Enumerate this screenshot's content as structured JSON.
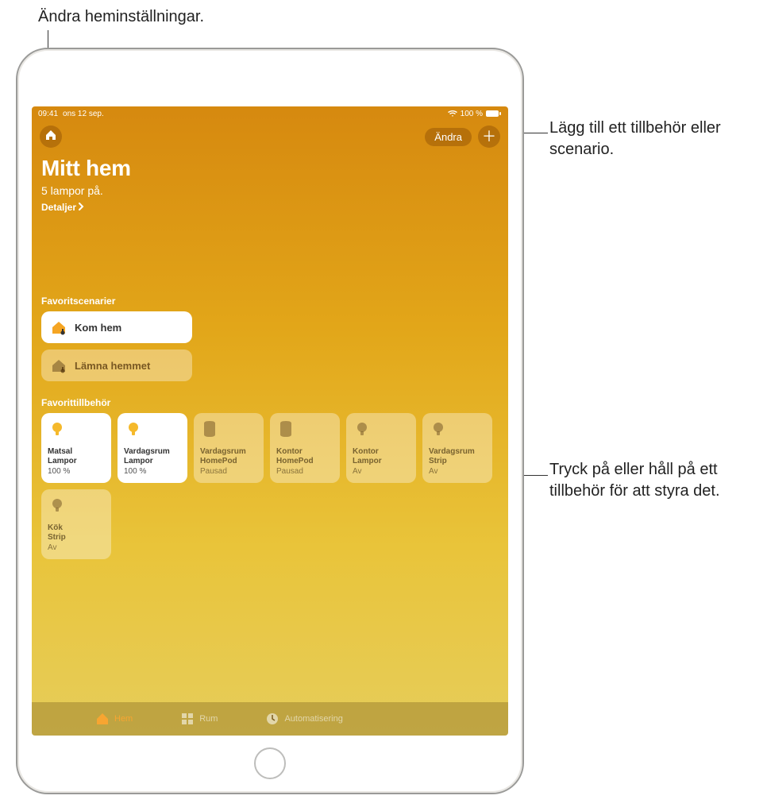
{
  "callouts": {
    "settings": "Ändra heminställningar.",
    "add": "Lägg till ett tillbehör eller scenario.",
    "accessory": "Tryck på eller håll på ett tillbehör för att styra det."
  },
  "statusBar": {
    "time": "09:41",
    "date": "ons 12 sep.",
    "battery": "100 %"
  },
  "header": {
    "editLabel": "Ändra",
    "title": "Mitt hem",
    "subtitle": "5 lampor på.",
    "detailsLabel": "Detaljer"
  },
  "sections": {
    "scenesLabel": "Favoritscenarier",
    "accessoriesLabel": "Favorittillbehör"
  },
  "scenes": [
    {
      "label": "Kom hem",
      "active": true,
      "icon": "arrive-home"
    },
    {
      "label": "Lämna hemmet",
      "active": false,
      "icon": "leave-home"
    }
  ],
  "accessories": [
    {
      "room": "Matsal",
      "name": "Lampor",
      "status": "100 %",
      "on": true,
      "icon": "bulb"
    },
    {
      "room": "Vardagsrum",
      "name": "Lampor",
      "status": "100 %",
      "on": true,
      "icon": "bulb"
    },
    {
      "room": "Vardagsrum",
      "name": "HomePod",
      "status": "Pausad",
      "on": false,
      "icon": "homepod"
    },
    {
      "room": "Kontor",
      "name": "HomePod",
      "status": "Pausad",
      "on": false,
      "icon": "homepod"
    },
    {
      "room": "Kontor",
      "name": "Lampor",
      "status": "Av",
      "on": false,
      "icon": "bulb"
    },
    {
      "room": "Vardagsrum",
      "name": "Strip",
      "status": "Av",
      "on": false,
      "icon": "bulb"
    },
    {
      "room": "Kök",
      "name": "Strip",
      "status": "Av",
      "on": false,
      "icon": "bulb"
    }
  ],
  "tabs": [
    {
      "label": "Hem",
      "active": true,
      "icon": "home"
    },
    {
      "label": "Rum",
      "active": false,
      "icon": "rooms"
    },
    {
      "label": "Automatisering",
      "active": false,
      "icon": "automation"
    }
  ],
  "colors": {
    "accent": "#f7a531",
    "tileOnBg": "#ffffff",
    "tileOffBg": "rgba(255,255,255,0.35)"
  }
}
